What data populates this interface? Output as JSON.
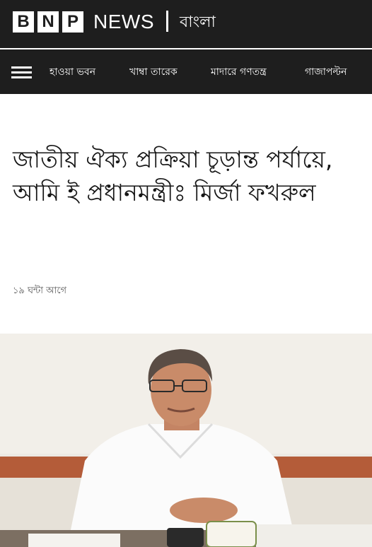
{
  "brand": {
    "logo_letters": [
      "B",
      "N",
      "P"
    ],
    "logo_word": "NEWS",
    "language": "বাংলা"
  },
  "colors": {
    "header_bg": "#1e1e1e",
    "header_text": "#ffffff",
    "headline_text": "#151515",
    "meta_text": "#555555"
  },
  "nav": {
    "menu_icon": "hamburger-menu-icon",
    "items": [
      {
        "label": "হাওয়া ভবন"
      },
      {
        "label": "খাম্বা তারেক"
      },
      {
        "label": "মাদারে গণতন্ত্র"
      },
      {
        "label": "গাজাপল্টন"
      }
    ]
  },
  "article": {
    "headline": "জাতীয় ঐক্য প্রক্রিয়া চূড়ান্ত পর্যায়ে, আমি ই প্রধানমন্ত্রীঃ মির্জা ফখরুল",
    "timestamp": "১৯ ঘন্টা আগে"
  }
}
